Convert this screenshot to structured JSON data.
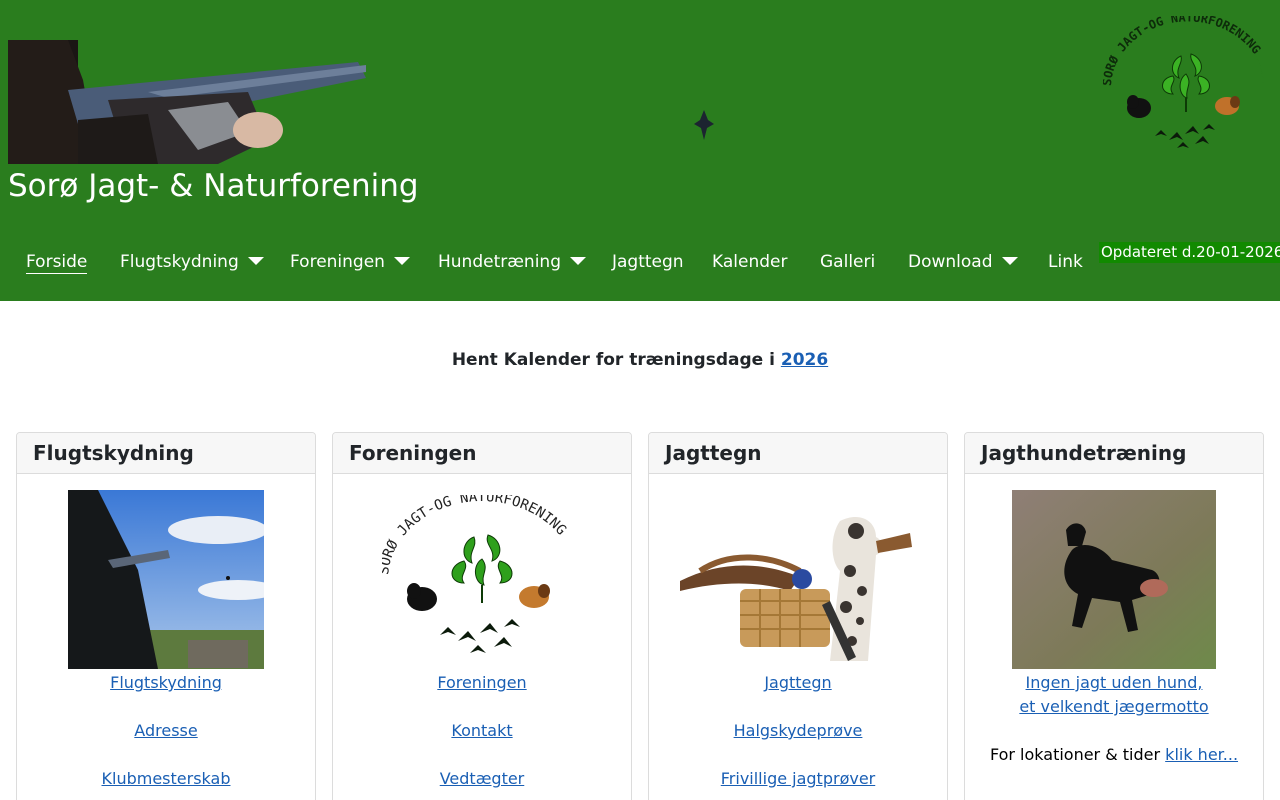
{
  "site": {
    "title": "Sorø Jagt- & Naturforening",
    "updated": "Opdateret d.20-01-2026",
    "header_bg": "#2a7d1e",
    "badge_bg": "#118a00",
    "link_color": "#1a5fb4"
  },
  "nav": {
    "items": [
      {
        "label": "Forside",
        "active": true,
        "dropdown": false
      },
      {
        "label": "Flugtskydning",
        "dropdown": true
      },
      {
        "label": "Foreningen",
        "dropdown": true
      },
      {
        "label": "Hundetræning",
        "dropdown": true
      },
      {
        "label": "Jagttegn",
        "dropdown": false
      },
      {
        "label": "Kalender",
        "dropdown": false
      },
      {
        "label": "Galleri",
        "dropdown": false
      },
      {
        "label": "Download",
        "dropdown": true
      },
      {
        "label": "Link",
        "dropdown": false
      }
    ]
  },
  "calendar": {
    "text": "Hent Kalender for træningsdage i ",
    "year_link": "2026"
  },
  "cards": [
    {
      "title": "Flugtskydning",
      "image": "shooter-photo",
      "links": [
        "Flugtskydning",
        "Adresse",
        "Klubmesterskab"
      ]
    },
    {
      "title": "Foreningen",
      "image": "club-logo",
      "links": [
        "Foreningen",
        "Kontakt",
        "Vedtægter"
      ]
    },
    {
      "title": "Jagttegn",
      "image": "hunting-dog-basket-photo",
      "links": [
        "Jagttegn",
        "Halgskydeprøve",
        "Frivillige jagtprøver"
      ]
    },
    {
      "title": "Jagthundetræning",
      "image": "black-dog-photo",
      "link_line1": "Ingen jagt uden hund,",
      "link_line2": "et velkendt jægermotto",
      "info_text": "For lokationer & tider ",
      "info_link": "klik her..."
    }
  ]
}
